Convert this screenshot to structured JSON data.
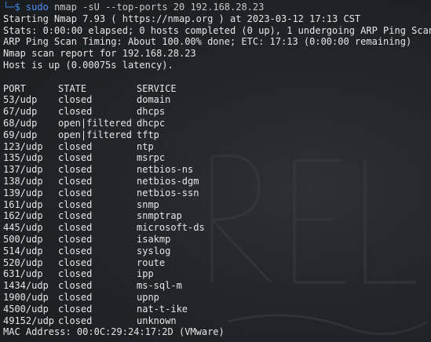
{
  "prompt": {
    "corner": "└─$",
    "command": "sudo",
    "args": "nmap -sU --top-ports 20 192.168.28.23"
  },
  "header_lines": [
    "Starting Nmap 7.93 ( https://nmap.org ) at 2023-03-12 17:13 CST",
    "Stats: 0:00:00 elapsed; 0 hosts completed (0 up), 1 undergoing ARP Ping Scan",
    "ARP Ping Scan Timing: About 100.00% done; ETC: 17:13 (0:00:00 remaining)",
    "Nmap scan report for 192.168.28.23",
    "Host is up (0.00075s latency)."
  ],
  "table": {
    "headers": {
      "port": "PORT",
      "state": "STATE",
      "service": "SERVICE"
    },
    "rows": [
      {
        "port": "53/udp",
        "state": "closed",
        "service": "domain"
      },
      {
        "port": "67/udp",
        "state": "closed",
        "service": "dhcps"
      },
      {
        "port": "68/udp",
        "state": "open|filtered",
        "service": "dhcpc"
      },
      {
        "port": "69/udp",
        "state": "open|filtered",
        "service": "tftp"
      },
      {
        "port": "123/udp",
        "state": "closed",
        "service": "ntp"
      },
      {
        "port": "135/udp",
        "state": "closed",
        "service": "msrpc"
      },
      {
        "port": "137/udp",
        "state": "closed",
        "service": "netbios-ns"
      },
      {
        "port": "138/udp",
        "state": "closed",
        "service": "netbios-dgm"
      },
      {
        "port": "139/udp",
        "state": "closed",
        "service": "netbios-ssn"
      },
      {
        "port": "161/udp",
        "state": "closed",
        "service": "snmp"
      },
      {
        "port": "162/udp",
        "state": "closed",
        "service": "snmptrap"
      },
      {
        "port": "445/udp",
        "state": "closed",
        "service": "microsoft-ds"
      },
      {
        "port": "500/udp",
        "state": "closed",
        "service": "isakmp"
      },
      {
        "port": "514/udp",
        "state": "closed",
        "service": "syslog"
      },
      {
        "port": "520/udp",
        "state": "closed",
        "service": "route"
      },
      {
        "port": "631/udp",
        "state": "closed",
        "service": "ipp"
      },
      {
        "port": "1434/udp",
        "state": "closed",
        "service": "ms-sql-m"
      },
      {
        "port": "1900/udp",
        "state": "closed",
        "service": "upnp"
      },
      {
        "port": "4500/udp",
        "state": "closed",
        "service": "nat-t-ike"
      },
      {
        "port": "49152/udp",
        "state": "closed",
        "service": "unknown"
      }
    ]
  },
  "footer": "MAC Address: 00:0C:29:24:17:2D (VMware)",
  "colors": {
    "background": "#1f2125",
    "text": "#e6e6e6",
    "prompt_accent": "#3b8eea",
    "command": "#4f8ff7"
  }
}
